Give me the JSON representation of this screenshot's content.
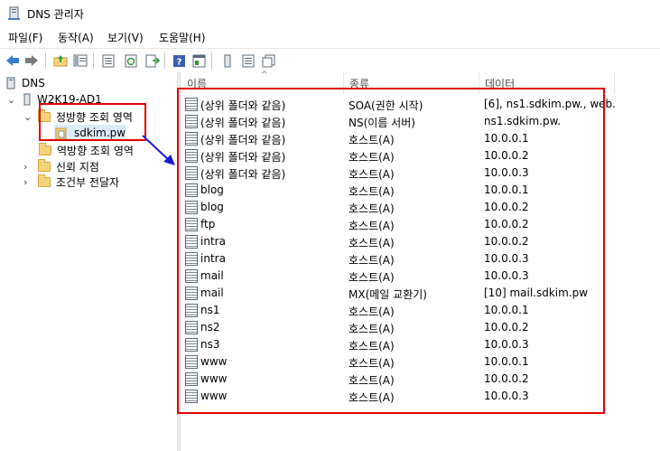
{
  "window": {
    "title": "DNS 관리자"
  },
  "menu": [
    "파일(F)",
    "동작(A)",
    "보기(V)",
    "도움말(H)"
  ],
  "tree": {
    "root": "DNS",
    "server": "W2K19-AD1",
    "forward_zone": "정방향 조회 영역",
    "zone": "sdkim.pw",
    "reverse_zone": "역방향 조회 영역",
    "trust_points": "신뢰 지점",
    "conditional_forwarders": "조건부 전달자"
  },
  "columns": {
    "name": "이름",
    "type": "종류",
    "data": "데이터"
  },
  "records": [
    {
      "name": "(상위 폴더와 같음)",
      "type": "SOA(권한 시작)",
      "data": "[6], ns1.sdkim.pw., web."
    },
    {
      "name": "(상위 폴더와 같음)",
      "type": "NS(이름 서버)",
      "data": "ns1.sdkim.pw."
    },
    {
      "name": "(상위 폴더와 같음)",
      "type": "호스트(A)",
      "data": "10.0.0.1"
    },
    {
      "name": "(상위 폴더와 같음)",
      "type": "호스트(A)",
      "data": "10.0.0.2"
    },
    {
      "name": "(상위 폴더와 같음)",
      "type": "호스트(A)",
      "data": "10.0.0.3"
    },
    {
      "name": "blog",
      "type": "호스트(A)",
      "data": "10.0.0.1"
    },
    {
      "name": "blog",
      "type": "호스트(A)",
      "data": "10.0.0.2"
    },
    {
      "name": "ftp",
      "type": "호스트(A)",
      "data": "10.0.0.2"
    },
    {
      "name": "intra",
      "type": "호스트(A)",
      "data": "10.0.0.2"
    },
    {
      "name": "intra",
      "type": "호스트(A)",
      "data": "10.0.0.3"
    },
    {
      "name": "mail",
      "type": "호스트(A)",
      "data": "10.0.0.3"
    },
    {
      "name": "mail",
      "type": "MX(메일 교환기)",
      "data": "[10]  mail.sdkim.pw"
    },
    {
      "name": "ns1",
      "type": "호스트(A)",
      "data": "10.0.0.1"
    },
    {
      "name": "ns2",
      "type": "호스트(A)",
      "data": "10.0.0.2"
    },
    {
      "name": "ns3",
      "type": "호스트(A)",
      "data": "10.0.0.3"
    },
    {
      "name": "www",
      "type": "호스트(A)",
      "data": "10.0.0.1"
    },
    {
      "name": "www",
      "type": "호스트(A)",
      "data": "10.0.0.2"
    },
    {
      "name": "www",
      "type": "호스트(A)",
      "data": "10.0.0.3"
    }
  ],
  "colors": {
    "highlight": "#e00000",
    "arrow": "#1a1adc",
    "folder": "#f6d37a"
  }
}
